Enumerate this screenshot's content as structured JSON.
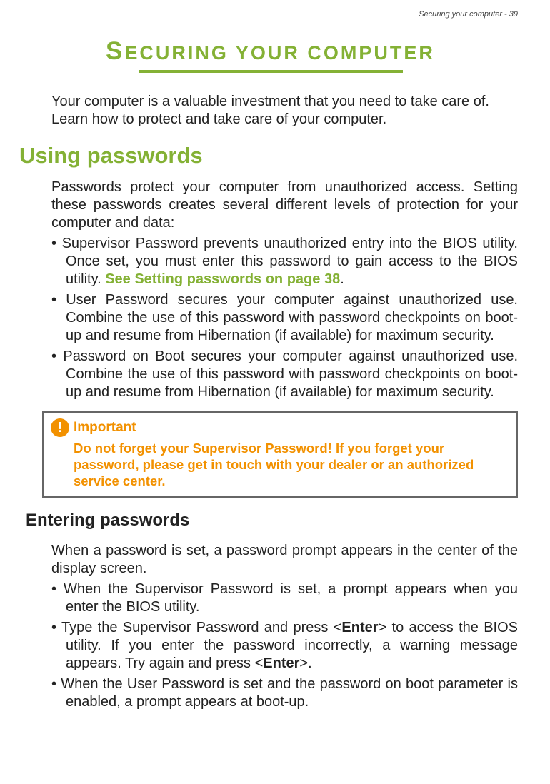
{
  "header": {
    "label": "Securing your computer - 39"
  },
  "chapter": {
    "title_part1": "S",
    "title_part2": "ECURING YOUR COMPUTER"
  },
  "intro": "Your computer is a valuable investment that you need to take care of. Learn how to protect and take care of your computer.",
  "section1": {
    "heading": "Using passwords",
    "paragraph": "Passwords protect your computer from unauthorized access. Setting these passwords creates several different levels of protection for your computer and data:",
    "bullets": {
      "item1_prefix": "Supervisor Password prevents unauthorized entry into the BIOS utility. Once set, you must enter this password to gain access to the BIOS utility. ",
      "item1_link": "See Setting passwords on page 38",
      "item1_suffix": ".",
      "item2": "User Password secures your computer against unauthorized use. Combine the use of this password with password checkpoints on boot-up and resume from Hibernation (if available) for maximum security.",
      "item3": "Password on Boot secures your computer against unauthorized use. Combine the use of this password with password checkpoints on boot-up and resume from Hibernation (if available) for maximum security."
    }
  },
  "important_box": {
    "icon": "!",
    "title": "Important",
    "text": "Do not forget your Supervisor Password! If you forget your password, please get in touch with your dealer or an authorized service center."
  },
  "section2": {
    "heading": "Entering passwords",
    "paragraph": "When a password is set, a password prompt appears in the center of the display screen.",
    "bullets": {
      "item1": "When the Supervisor Password is set, a prompt appears when you enter the BIOS utility.",
      "item2_prefix": "Type the Supervisor Password and press <",
      "item2_bold1": "Enter",
      "item2_mid": "> to access the BIOS utility. If you enter the password incorrectly, a warning message appears. Try again and press <",
      "item2_bold2": "Enter",
      "item2_suffix": ">.",
      "item3": "When the User Password is set and the password on boot parameter is enabled, a prompt appears at boot-up."
    }
  }
}
